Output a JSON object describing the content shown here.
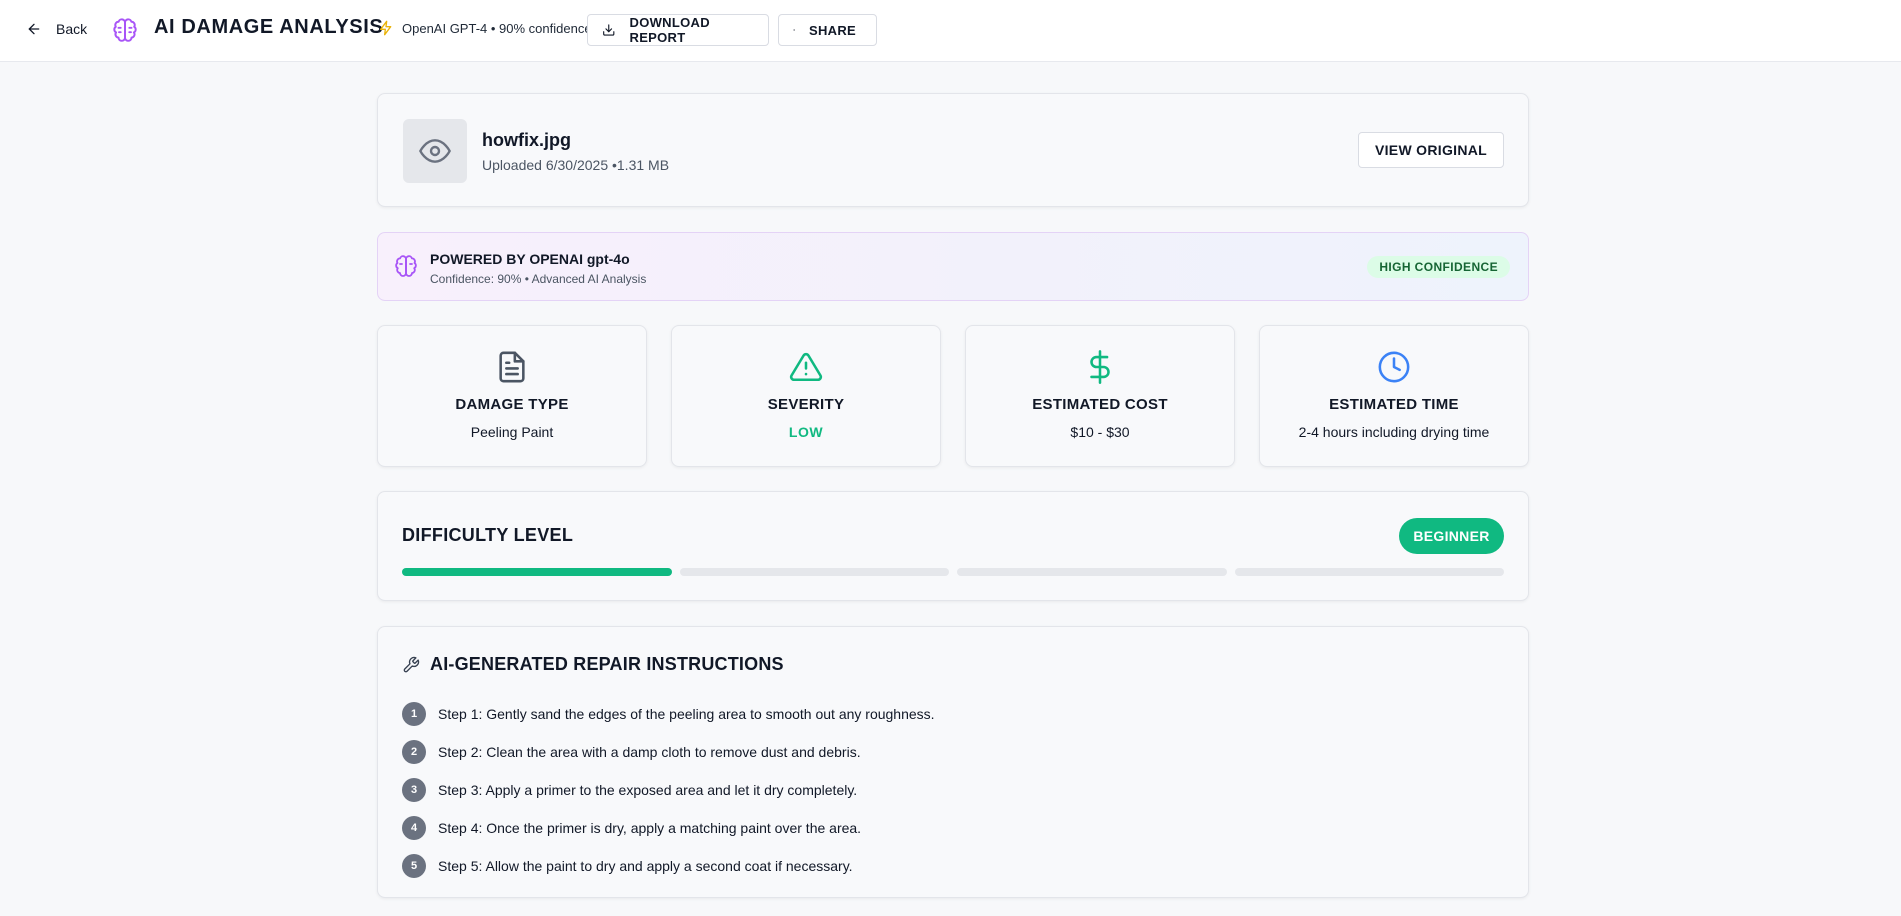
{
  "header": {
    "back_label": "Back",
    "title": "AI DAMAGE ANALYSIS",
    "model_tag": "OpenAI GPT-4 • 90% confidence",
    "download_label": "DOWNLOAD REPORT",
    "share_label": "SHARE"
  },
  "file": {
    "name": "howfix.jpg",
    "meta": "Uploaded 6/30/2025 •1.31 MB",
    "view_label": "VIEW ORIGINAL"
  },
  "ai": {
    "title": "POWERED BY OPENAI gpt-4o",
    "subtitle": "Confidence: 90% • Advanced AI Analysis",
    "badge": "HIGH CONFIDENCE"
  },
  "stats": [
    {
      "label": "DAMAGE TYPE",
      "value": "Peeling Paint",
      "icon": "document-icon"
    },
    {
      "label": "SEVERITY",
      "value": "LOW",
      "icon": "warning-icon"
    },
    {
      "label": "ESTIMATED COST",
      "value": "$10 - $30",
      "icon": "dollar-icon"
    },
    {
      "label": "ESTIMATED TIME",
      "value": "2-4 hours including drying time",
      "icon": "clock-icon"
    }
  ],
  "difficulty": {
    "title": "DIFFICULTY LEVEL",
    "level": "BEGINNER",
    "filled": 1,
    "total": 4
  },
  "instructions": {
    "title": "AI-GENERATED REPAIR INSTRUCTIONS",
    "steps": [
      {
        "num": "1",
        "text": "Step 1: Gently sand the edges of the peeling area to smooth out any roughness."
      },
      {
        "num": "2",
        "text": "Step 2: Clean the area with a damp cloth to remove dust and debris."
      },
      {
        "num": "3",
        "text": "Step 3: Apply a primer to the exposed area and let it dry completely."
      },
      {
        "num": "4",
        "text": "Step 4: Once the primer is dry, apply a matching paint over the area."
      },
      {
        "num": "5",
        "text": "Step 5: Allow the paint to dry and apply a second coat if necessary."
      }
    ]
  },
  "colors": {
    "accent_green": "#10b981",
    "accent_purple": "#a855f7",
    "accent_blue": "#3b82f6",
    "bolt_yellow": "#eab308"
  }
}
